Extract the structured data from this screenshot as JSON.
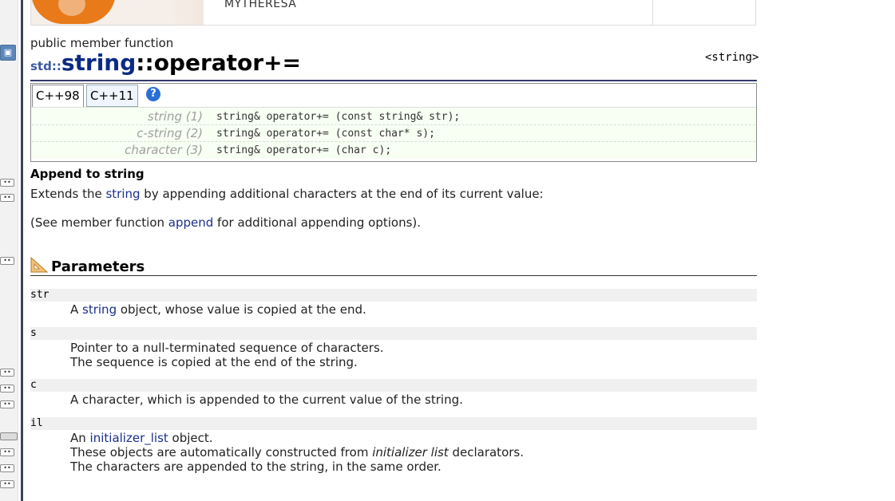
{
  "ad": {
    "brand": "MYTHERESA"
  },
  "header": {
    "kind": "public member function",
    "namespace": "std::",
    "class_name": "string",
    "separator": "::",
    "operator_name": "operator+=",
    "header_ref": "<string>"
  },
  "tabs": [
    {
      "label": "C++98"
    },
    {
      "label": "C++11"
    }
  ],
  "help_icon": {
    "glyph": "?"
  },
  "prototypes": [
    {
      "label": "string (1)",
      "code": "string& operator+= (const string& str);"
    },
    {
      "label": "c-string (2)",
      "code": "string& operator+= (const char* s);"
    },
    {
      "label": "character (3)",
      "code": "string& operator+= (char c);"
    }
  ],
  "description": {
    "title": "Append to string",
    "line1_pre": "Extends the ",
    "line1_link": "string",
    "line1_post": " by appending additional characters at the end of its current value:",
    "line2_pre": "(See member function ",
    "line2_link": "append",
    "line2_post": " for additional appending options)."
  },
  "parameters": {
    "title": "Parameters",
    "items": [
      {
        "name": "str",
        "d1_pre": "A ",
        "d1_link": "string",
        "d1_post": " object, whose value is copied at the end."
      },
      {
        "name": "s",
        "d1": "Pointer to a null-terminated sequence of characters.",
        "d2": "The sequence is copied at the end of the string."
      },
      {
        "name": "c",
        "d1": "A character, which is appended to the current value of the string."
      },
      {
        "name": "il",
        "d1_pre": "An ",
        "d1_link": "initializer_list",
        "d1_post": " object.",
        "d2_pre": "These objects are automatically constructed from ",
        "d2_em": "initializer list",
        "d2_post": " declarators.",
        "d3": "The characters are appended to the string, in the same order."
      }
    ]
  },
  "colors": {
    "link": "#1b2f8c",
    "title_class": "#0b2a86",
    "proto_bg": "#f8fff3",
    "help": "#2a6fd6"
  }
}
